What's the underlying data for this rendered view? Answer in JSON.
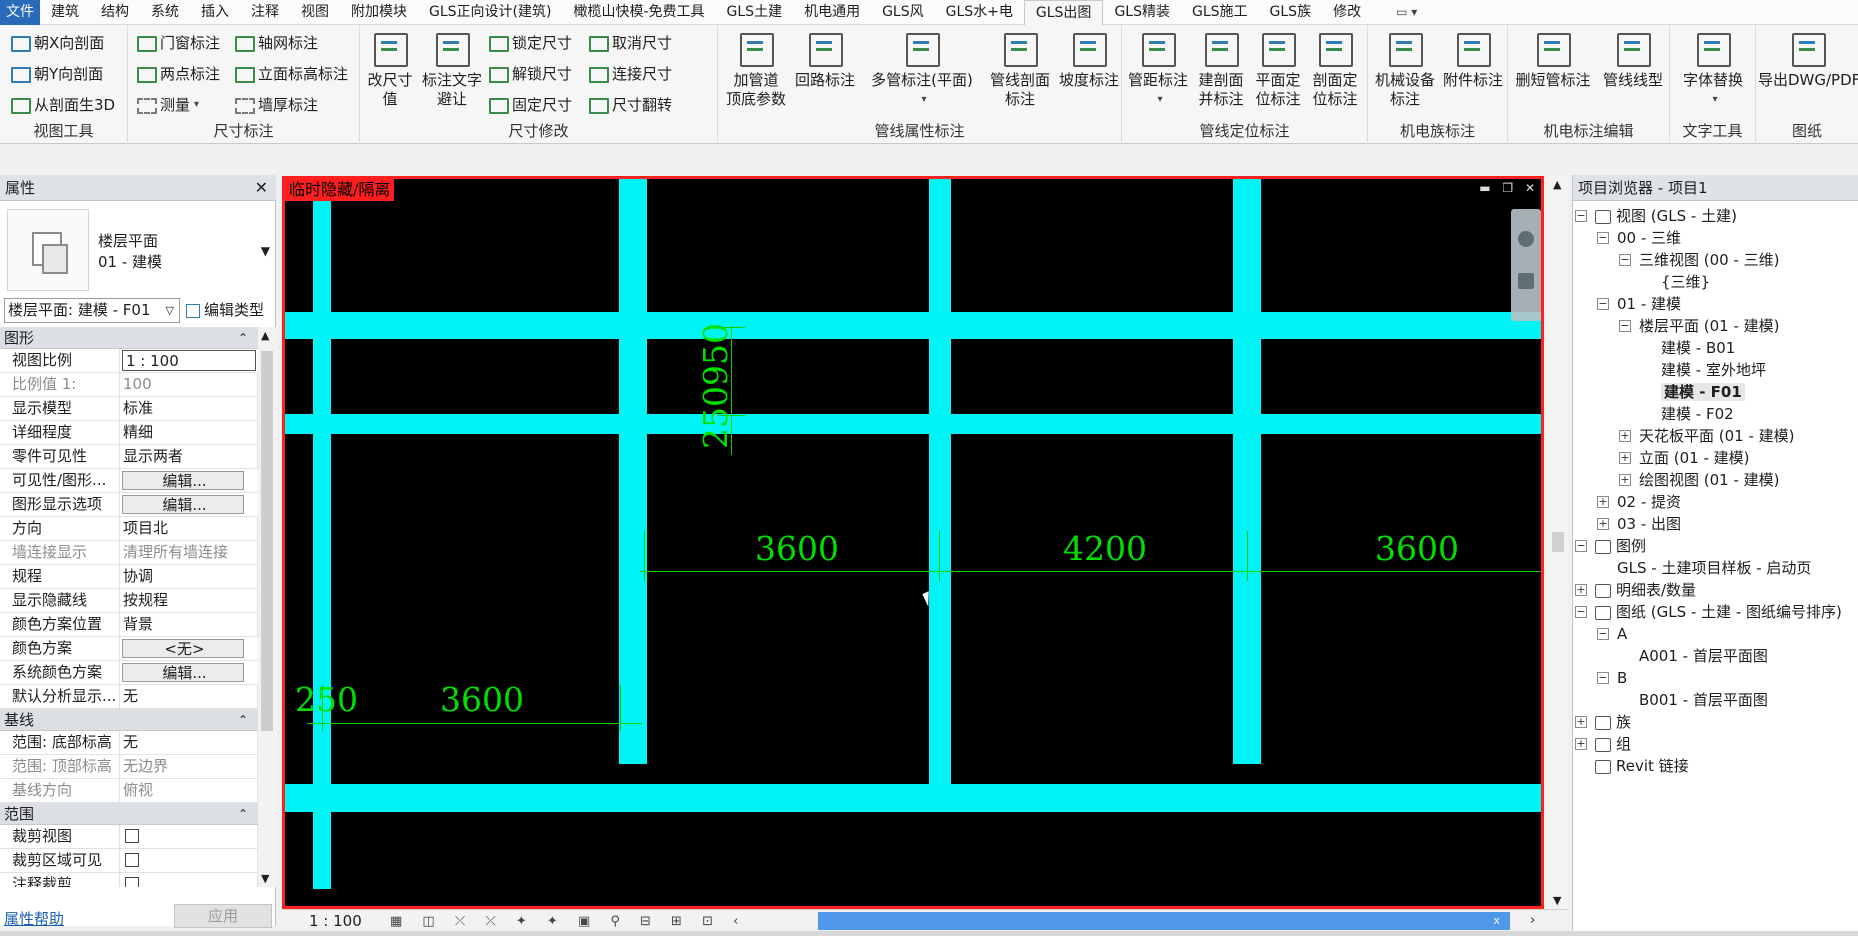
{
  "menu": {
    "tabs": [
      "文件",
      "建筑",
      "结构",
      "系统",
      "插入",
      "注释",
      "视图",
      "附加模块",
      "GLS正向设计(建筑)",
      "橄榄山快模-免费工具",
      "GLS土建",
      "机电通用",
      "GLS风",
      "GLS水+电",
      "GLS出图",
      "GLS精装",
      "GLS施工",
      "GLS族",
      "修改"
    ],
    "active": "GLS出图",
    "qat": "▭ ▾"
  },
  "ribbon": {
    "panels": {
      "view_tools": "视图工具",
      "dim_annot": "尺寸标注",
      "dim_modify": "尺寸修改",
      "pipe_attr": "管线属性标注",
      "pipe_pos": "管线定位标注",
      "mep_family": "机电族标注",
      "mep_edit": "机电标注编辑",
      "text_tools": "文字工具",
      "sheet": "图纸"
    },
    "view_tools": [
      "朝X向剖面",
      "朝Y向剖面",
      "从剖面生3D"
    ],
    "dim_annot": [
      "门窗标注",
      "轴网标注",
      "两点标注",
      "立面标高标注",
      "测量",
      "墙厚标注"
    ],
    "dim_modify_big": [
      "改尺寸\n值",
      "标注文字\n避让"
    ],
    "dim_modify": [
      "锁定尺寸",
      "取消尺寸",
      "解锁尺寸",
      "连接尺寸",
      "固定尺寸",
      "尺寸翻转"
    ],
    "pipe_attr": [
      "加管道\n顶底参数",
      "回路标注",
      "多管标注(平面)",
      "管线剖面\n标注",
      "坡度标注"
    ],
    "pipe_pos": [
      "管距标注",
      "建剖面\n并标注",
      "平面定\n位标注",
      "剖面定\n位标注"
    ],
    "mep_family": [
      "机械设备\n标注",
      "附件标注"
    ],
    "mep_edit": [
      "删短管标注",
      "管线线型"
    ],
    "text_tools": [
      "字体替换"
    ],
    "sheet": [
      "导出DWG/PDF"
    ]
  },
  "properties": {
    "title": "属性",
    "close": "✕",
    "type_line1": "楼层平面",
    "type_line2": "01 - 建模",
    "selector": "楼层平面: 建模 - F01",
    "edit_type": "编辑类型",
    "groups": [
      {
        "name": "图形",
        "rows": [
          {
            "k": "视图比例",
            "v": "1 : 100",
            "style": "boxed"
          },
          {
            "k": "比例值 1:",
            "v": "100",
            "style": "dim"
          },
          {
            "k": "显示模型",
            "v": "标准"
          },
          {
            "k": "详细程度",
            "v": "精细"
          },
          {
            "k": "零件可见性",
            "v": "显示两者"
          },
          {
            "k": "可见性/图形...",
            "v": "编辑...",
            "style": "btn"
          },
          {
            "k": "图形显示选项",
            "v": "编辑...",
            "style": "btn"
          },
          {
            "k": "方向",
            "v": "项目北"
          },
          {
            "k": "墙连接显示",
            "v": "清理所有墙连接",
            "style": "dim"
          },
          {
            "k": "规程",
            "v": "协调"
          },
          {
            "k": "显示隐藏线",
            "v": "按规程"
          },
          {
            "k": "颜色方案位置",
            "v": "背景"
          },
          {
            "k": "颜色方案",
            "v": "<无>",
            "style": "btn"
          },
          {
            "k": "系统颜色方案",
            "v": "编辑...",
            "style": "btn"
          },
          {
            "k": "默认分析显示...",
            "v": "无"
          }
        ]
      },
      {
        "name": "基线",
        "rows": [
          {
            "k": "范围: 底部标高",
            "v": "无"
          },
          {
            "k": "范围: 顶部标高",
            "v": "无边界",
            "style": "dim"
          },
          {
            "k": "基线方向",
            "v": "俯视",
            "style": "dim"
          }
        ]
      },
      {
        "name": "范围",
        "rows": [
          {
            "k": "裁剪视图",
            "v": "",
            "style": "chk"
          },
          {
            "k": "裁剪区域可见",
            "v": "",
            "style": "chk"
          },
          {
            "k": "注释裁剪",
            "v": "",
            "style": "chk"
          }
        ]
      }
    ],
    "help_link": "属性帮助",
    "apply": "应用"
  },
  "viewport": {
    "badge": "临时隐藏/隔离",
    "window_controls": "▬ ❐ ✕",
    "dims": {
      "d1": "3600",
      "d2": "4200",
      "d3": "3600",
      "d4": "250",
      "d5": "3600",
      "d6": "250950"
    },
    "colors": {
      "beam": "#00f4f6",
      "dim": "#00e000",
      "border": "#ff2020"
    }
  },
  "status": {
    "scale": "1 : 100",
    "icons": "▦ ◫ ⤫ ⤫ ✦ ✦ ▣ ⚲ ⊟ ⊞ ⊡ ‹",
    "hscroll_close": "x"
  },
  "browser": {
    "title": "项目浏览器 - 项目1",
    "close": "✕",
    "nodes": [
      {
        "lvl": 0,
        "tg": "−",
        "icon": true,
        "label": "视图 (GLS - 土建)"
      },
      {
        "lvl": 1,
        "tg": "−",
        "label": "00 - 三维"
      },
      {
        "lvl": 2,
        "tg": "−",
        "label": "三维视图 (00 - 三维)"
      },
      {
        "lvl": 3,
        "label": "{三维}"
      },
      {
        "lvl": 1,
        "tg": "−",
        "label": "01 - 建模"
      },
      {
        "lvl": 2,
        "tg": "−",
        "label": "楼层平面 (01 - 建模)"
      },
      {
        "lvl": 3,
        "label": "建模 - B01"
      },
      {
        "lvl": 3,
        "label": "建模 - 室外地坪"
      },
      {
        "lvl": 3,
        "label": "建模 - F01",
        "sel": true
      },
      {
        "lvl": 3,
        "label": "建模 - F02"
      },
      {
        "lvl": 2,
        "tg": "+",
        "label": "天花板平面 (01 - 建模)"
      },
      {
        "lvl": 2,
        "tg": "+",
        "label": "立面 (01 - 建模)"
      },
      {
        "lvl": 2,
        "tg": "+",
        "label": "绘图视图 (01 - 建模)"
      },
      {
        "lvl": 1,
        "tg": "+",
        "label": "02 - 提资"
      },
      {
        "lvl": 1,
        "tg": "+",
        "label": "03 - 出图"
      },
      {
        "lvl": 0,
        "tg": "−",
        "icon": true,
        "label": "图例"
      },
      {
        "lvl": 1,
        "label": "GLS - 土建项目样板 - 启动页"
      },
      {
        "lvl": 0,
        "tg": "+",
        "icon": true,
        "label": "明细表/数量"
      },
      {
        "lvl": 0,
        "tg": "−",
        "icon": true,
        "label": "图纸 (GLS - 土建 - 图纸编号排序)"
      },
      {
        "lvl": 1,
        "tg": "−",
        "label": "A"
      },
      {
        "lvl": 2,
        "label": "A001 - 首层平面图"
      },
      {
        "lvl": 1,
        "tg": "−",
        "label": "B"
      },
      {
        "lvl": 2,
        "label": "B001 - 首层平面图"
      },
      {
        "lvl": 0,
        "tg": "+",
        "icon": true,
        "label": "族"
      },
      {
        "lvl": 0,
        "tg": "+",
        "icon": true,
        "label": "组"
      },
      {
        "lvl": 0,
        "icon": true,
        "label": "Revit 链接"
      }
    ]
  }
}
